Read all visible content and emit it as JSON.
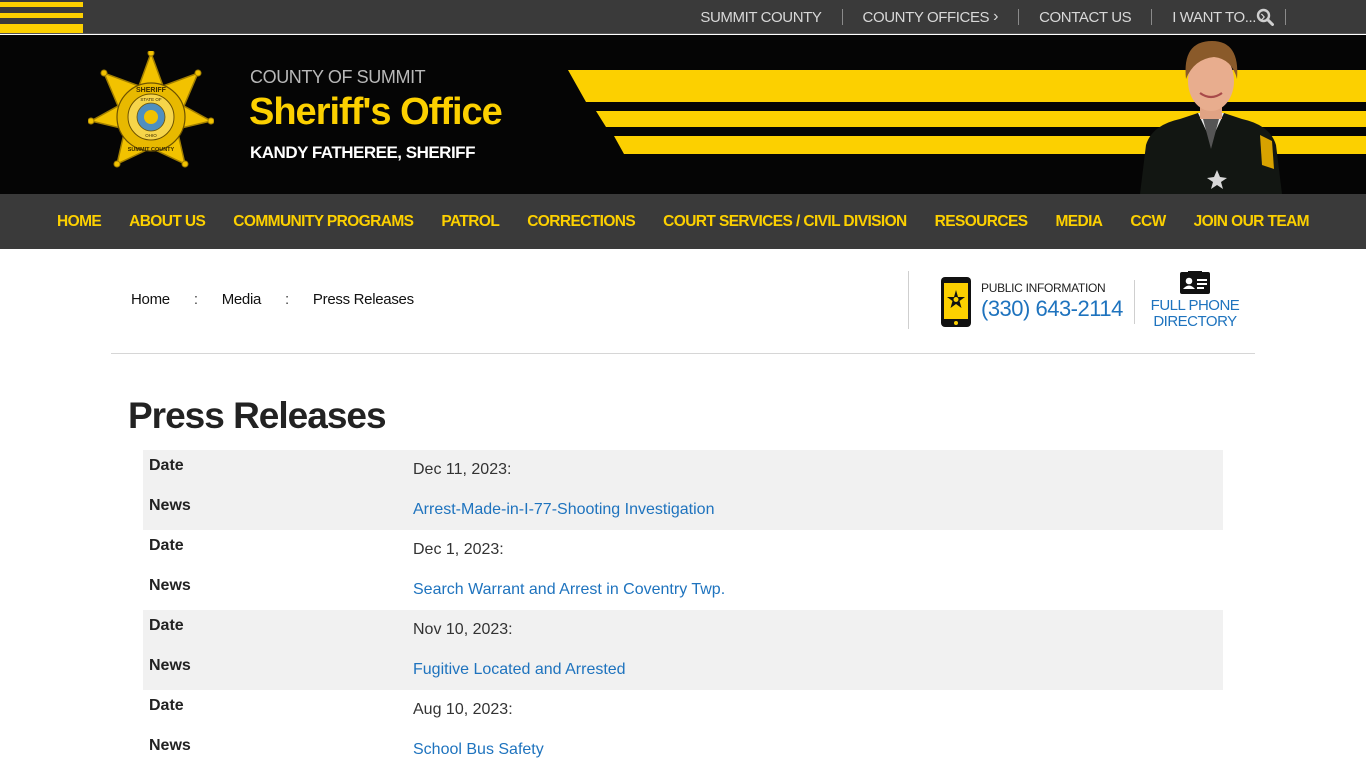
{
  "topbar": {
    "links": [
      {
        "label": "SUMMIT COUNTY",
        "chevron": ""
      },
      {
        "label": "COUNTY OFFICES",
        "chevron": "›"
      },
      {
        "label": "CONTACT US",
        "chevron": ""
      },
      {
        "label": "I WANT TO...",
        "chevron": "›"
      }
    ],
    "search_icon": "search-icon"
  },
  "header": {
    "org_small": "COUNTY OF SUMMIT",
    "org_title": "Sheriff's Office",
    "sheriff_name": "KANDY FATHEREE, SHERIFF",
    "badge_text": {
      "top": "KANDY FATHEREE",
      "sheriff": "SHERIFF",
      "state": "STATE OF",
      "ohio": "OHIO",
      "county": "SUMMIT COUNTY"
    },
    "colors": {
      "accent": "#fcd000",
      "background": "#050505"
    }
  },
  "mainnav": [
    "HOME",
    "ABOUT US",
    "COMMUNITY PROGRAMS",
    "PATROL",
    "CORRECTIONS",
    "COURT SERVICES / CIVIL DIVISION",
    "RESOURCES",
    "MEDIA",
    "CCW",
    "JOIN OUR TEAM"
  ],
  "breadcrumb": {
    "items": [
      "Home",
      "Media",
      "Press Releases"
    ],
    "separator": ":"
  },
  "contact": {
    "public_info_label": "PUBLIC INFORMATION",
    "public_info_number": "(330) 643-2114",
    "directory_label": "FULL PHONE DIRECTORY"
  },
  "page": {
    "title": "Press Releases"
  },
  "releases": [
    {
      "date_label": "Date",
      "date": "Dec 11, 2023:",
      "news_label": "News",
      "news": "Arrest-Made-in-I-77-Shooting Investigation"
    },
    {
      "date_label": "Date",
      "date": "Dec 1, 2023:",
      "news_label": "News",
      "news": "Search Warrant and Arrest in Coventry Twp."
    },
    {
      "date_label": "Date",
      "date": "Nov 10, 2023:",
      "news_label": "News",
      "news": "Fugitive Located and Arrested"
    },
    {
      "date_label": "Date",
      "date": "Aug 10, 2023:",
      "news_label": "News",
      "news": "School Bus Safety"
    }
  ]
}
